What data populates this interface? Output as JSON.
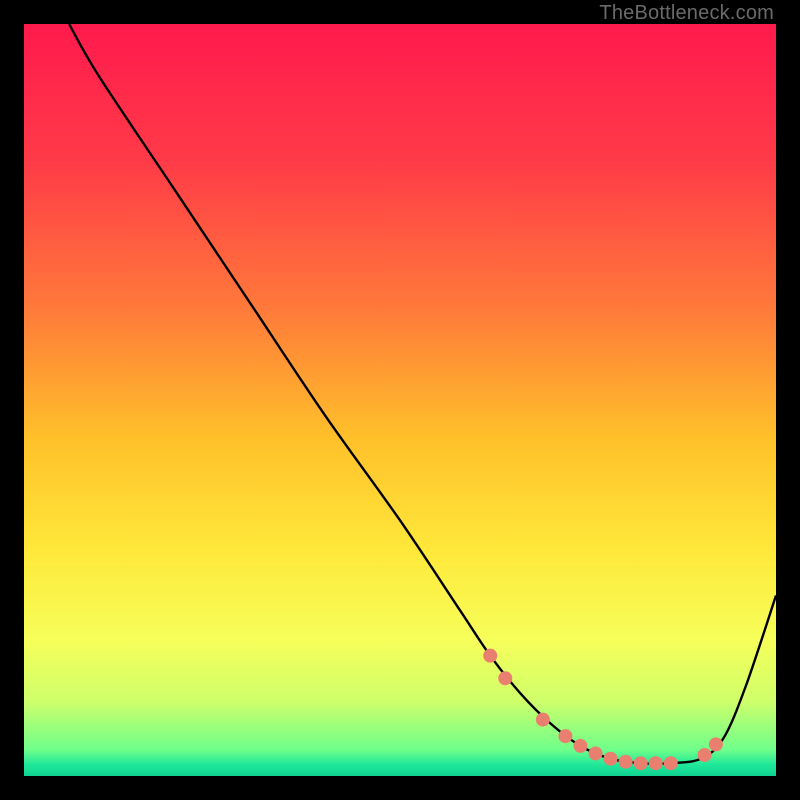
{
  "watermark": "TheBottleneck.com",
  "chart_data": {
    "type": "line",
    "title": "",
    "xlabel": "",
    "ylabel": "",
    "xlim": [
      0,
      100
    ],
    "ylim": [
      0,
      100
    ],
    "gradient_stops": [
      {
        "offset": 0,
        "color": "#ff1a4d"
      },
      {
        "offset": 0.18,
        "color": "#ff3a48"
      },
      {
        "offset": 0.38,
        "color": "#ff7a3a"
      },
      {
        "offset": 0.55,
        "color": "#ffc02a"
      },
      {
        "offset": 0.7,
        "color": "#ffe83a"
      },
      {
        "offset": 0.82,
        "color": "#f6ff5a"
      },
      {
        "offset": 0.9,
        "color": "#cfff6a"
      },
      {
        "offset": 0.965,
        "color": "#6fff8a"
      },
      {
        "offset": 0.985,
        "color": "#1fe89a"
      },
      {
        "offset": 1.0,
        "color": "#0fd090"
      }
    ],
    "series": [
      {
        "name": "bottleneck-curve",
        "x": [
          6,
          10,
          20,
          30,
          40,
          50,
          58,
          62,
          66,
          70,
          74,
          78,
          82,
          86,
          90,
          93,
          96,
          100
        ],
        "y": [
          100,
          93,
          78,
          63,
          48,
          34,
          22,
          16,
          11,
          7,
          4,
          2.3,
          1.7,
          1.7,
          2.3,
          5,
          12,
          24
        ]
      }
    ],
    "markers": {
      "name": "highlight-dots",
      "color": "#e9806f",
      "r": 7,
      "points": [
        {
          "x": 62,
          "y": 16
        },
        {
          "x": 64,
          "y": 13
        },
        {
          "x": 69,
          "y": 7.5
        },
        {
          "x": 72,
          "y": 5.3
        },
        {
          "x": 74,
          "y": 4
        },
        {
          "x": 76,
          "y": 3
        },
        {
          "x": 78,
          "y": 2.3
        },
        {
          "x": 80,
          "y": 1.9
        },
        {
          "x": 82,
          "y": 1.7
        },
        {
          "x": 84,
          "y": 1.7
        },
        {
          "x": 86,
          "y": 1.7
        },
        {
          "x": 90.5,
          "y": 2.8
        },
        {
          "x": 92,
          "y": 4.2
        }
      ]
    }
  }
}
